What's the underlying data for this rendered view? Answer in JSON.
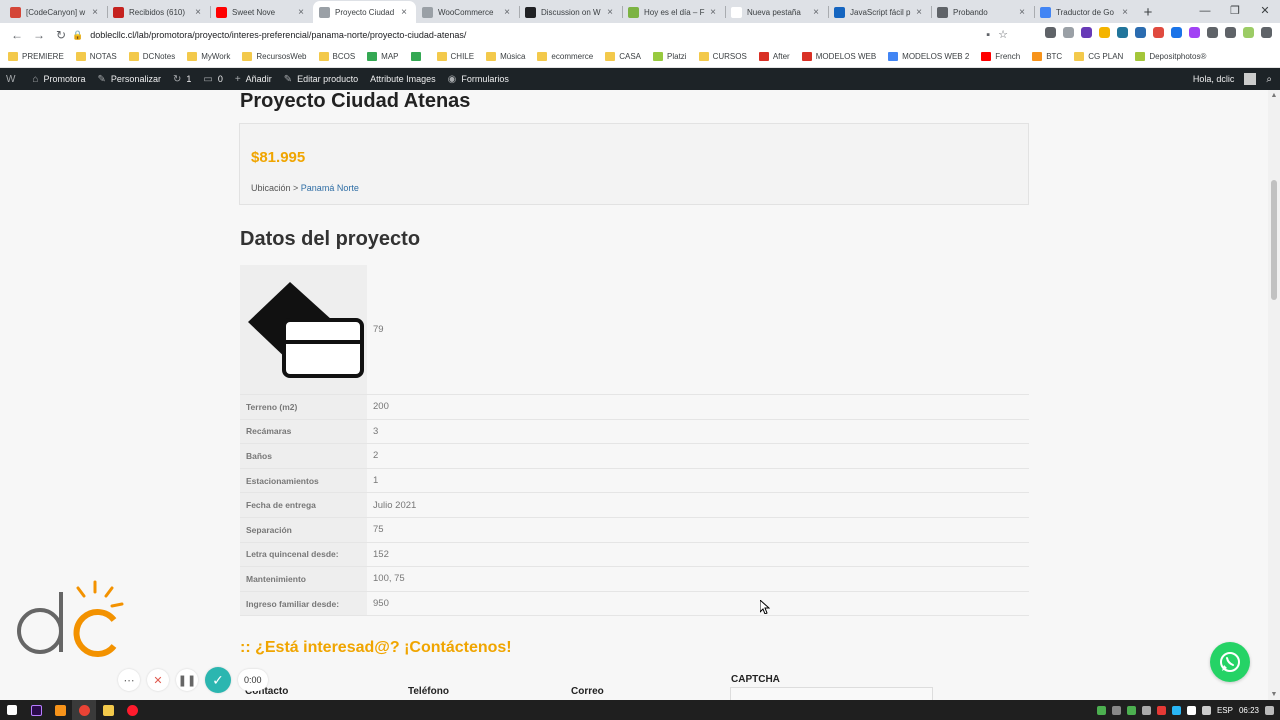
{
  "browser": {
    "tabs": [
      {
        "title": "[CodeCanyon] w",
        "color": "#d44638",
        "active": false
      },
      {
        "title": "Recibidos (610)",
        "color": "#c5221f",
        "active": false
      },
      {
        "title": "Sweet Nove",
        "color": "#ff0000",
        "active": false
      },
      {
        "title": "Proyecto Ciudad",
        "color": "#9aa0a6",
        "active": true
      },
      {
        "title": "WooCommerce",
        "color": "#9aa0a6",
        "active": false
      },
      {
        "title": "Discussion on W",
        "color": "#202124",
        "active": false
      },
      {
        "title": "Hoy es el día – F",
        "color": "#7cb342",
        "active": false
      },
      {
        "title": "Nueva pestaña",
        "color": "#ffffff",
        "active": false
      },
      {
        "title": "JavaScript fácil p",
        "color": "#1565c0",
        "active": false
      },
      {
        "title": "Probando",
        "color": "#5f6368",
        "active": false
      },
      {
        "title": "Traductor de Go",
        "color": "#4285f4",
        "active": false
      }
    ],
    "url": "doblecllc.cl/lab/promotora/proyecto/interes-preferencial/panama-norte/proyecto-ciudad-atenas/",
    "bookmarks": [
      {
        "label": "PREMIERE",
        "folder": true
      },
      {
        "label": "NOTAS",
        "folder": true
      },
      {
        "label": "DCNotes",
        "folder": true
      },
      {
        "label": "MyWork",
        "folder": true
      },
      {
        "label": "RecursosWeb",
        "folder": true
      },
      {
        "label": "BCOS",
        "folder": true
      },
      {
        "label": "MAP",
        "folder": false,
        "color": "#34a853"
      },
      {
        "label": "",
        "folder": false,
        "color": "#34a853"
      },
      {
        "label": "CHILE",
        "folder": true
      },
      {
        "label": "Música",
        "folder": true
      },
      {
        "label": "ecommerce",
        "folder": true
      },
      {
        "label": "CASA",
        "folder": true
      },
      {
        "label": "Platzi",
        "folder": false,
        "color": "#98ca3f"
      },
      {
        "label": "CURSOS",
        "folder": true
      },
      {
        "label": "After",
        "folder": false,
        "color": "#d93025"
      },
      {
        "label": "MODELOS WEB",
        "folder": false,
        "color": "#d93025"
      },
      {
        "label": "MODELOS WEB 2",
        "folder": false,
        "color": "#4285f4"
      },
      {
        "label": "French",
        "folder": false,
        "color": "#ff0000"
      },
      {
        "label": "BTC",
        "folder": false,
        "color": "#f7931a"
      },
      {
        "label": "CG PLAN",
        "folder": false,
        "color": "#f3c94b"
      },
      {
        "label": "Depositphotos®",
        "folder": false,
        "color": "#a4c639"
      }
    ]
  },
  "adminbar": {
    "items": [
      {
        "icon": "W",
        "label": ""
      },
      {
        "icon": "⌂",
        "label": "Promotora"
      },
      {
        "icon": "✎",
        "label": "Personalizar"
      },
      {
        "icon": "↻",
        "label": "1"
      },
      {
        "icon": "▭",
        "label": "0"
      },
      {
        "icon": "+",
        "label": "Añadir"
      },
      {
        "icon": "✎",
        "label": "Editar producto"
      },
      {
        "icon": "",
        "label": "Attribute Images"
      },
      {
        "icon": "◉",
        "label": "Formularios"
      }
    ],
    "greeting": "Hola, dclic"
  },
  "product": {
    "title": "Proyecto Ciudad Atenas",
    "price": "$81.995",
    "location_label": "Ubicación >",
    "location_link": "Panamá Norte"
  },
  "datos": {
    "heading": "Datos del proyecto",
    "first_value": "79",
    "rows": [
      {
        "label": "Terreno (m2)",
        "value": "200"
      },
      {
        "label": "Recámaras",
        "value": "3"
      },
      {
        "label": "Baños",
        "value": "2"
      },
      {
        "label": "Estacionamientos",
        "value": "1"
      },
      {
        "label": "Fecha de entrega",
        "value": "Julio 2021"
      },
      {
        "label": "Separación",
        "value": "75"
      },
      {
        "label": "Letra quincenal desde:",
        "value": "152"
      },
      {
        "label": "Mantenimiento",
        "value": "100, 75"
      },
      {
        "label": "Ingreso familiar desde:",
        "value": "950"
      }
    ]
  },
  "contact": {
    "heading": ":: ¿Está interesad@? ¡Contáctenos!",
    "fields": {
      "contacto": "Contacto",
      "telefono": "Teléfono",
      "correo": "Correo",
      "captcha": "CAPTCHA"
    }
  },
  "recorder": {
    "time": "0:00"
  },
  "tray": {
    "lang": "ESP",
    "clock": "06:23"
  },
  "colors": {
    "accent": "#f0a500",
    "adminbar": "#1d2327",
    "whatsapp": "#25d366",
    "link": "#2f6ea5"
  }
}
